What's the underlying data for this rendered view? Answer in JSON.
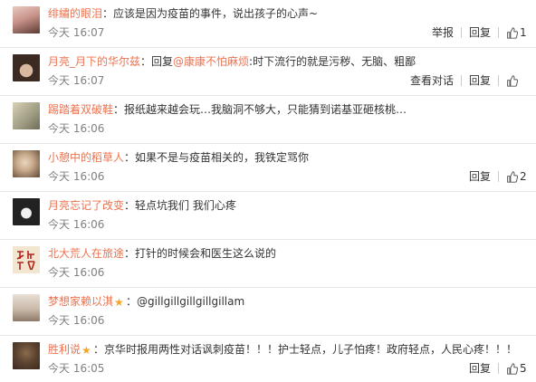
{
  "comments": [
    {
      "username": "绯繡的眼泪",
      "text": "：应该是因为疫苗的事件，说出孩子的心声~",
      "time": "今天 16:07",
      "actions": [
        "举报",
        "回复"
      ],
      "likes": "1",
      "avatar_colors": [
        "#e8c9c0",
        "#5a3b33"
      ],
      "star": false
    },
    {
      "username": "月亮_月下的华尔兹",
      "prefix": "：回复",
      "mention": "@康康不怕麻烦",
      "text": ":时下流行的就是污秽、无脑、粗鄙",
      "time": "今天 16:07",
      "actions": [
        "查看对话",
        "回复"
      ],
      "likes": "",
      "avatar_colors": [
        "#3a2a22",
        "#d9b8a0"
      ],
      "star": false
    },
    {
      "username": "踢踏着双破鞋",
      "text": "：报纸越来越会玩…我脑洞不够大，只能猜到诺基亚砸核桃…",
      "time": "今天 16:06",
      "actions": [],
      "likes": "",
      "avatar_colors": [
        "#9c9a80",
        "#d8d2b8"
      ],
      "star": false
    },
    {
      "username": "小憩中的稻草人",
      "text": "：如果不是与疫苗相关的，我铁定骂你",
      "time": "今天 16:06",
      "actions": [
        "回复"
      ],
      "likes": "2",
      "avatar_colors": [
        "#c7a98a",
        "#5b4636"
      ],
      "star": false
    },
    {
      "username": "月亮忘记了改变",
      "text": "：轻点坑我们 我们心疼",
      "time": "今天 16:06",
      "actions": [],
      "likes": "",
      "avatar_colors": [
        "#222222",
        "#f0f0f0"
      ],
      "star": false
    },
    {
      "username": "北大荒人在旅途",
      "text": "：打针的时候会和医生这么说的",
      "time": "今天 16:06",
      "actions": [],
      "likes": "",
      "avatar_colors": [
        "#b8201d",
        "#f2e6d0"
      ],
      "star": false
    },
    {
      "username": "梦想家赖以淇",
      "text": "：@gillgillgillgillgillam",
      "time": "今天 16:06",
      "actions": [],
      "likes": "",
      "avatar_colors": [
        "#c9b9a9",
        "#e9dfd5"
      ],
      "star": true
    },
    {
      "username": "胜利说",
      "text": "：京华时报用两性对话讽刺疫苗！！！护士轻点，儿子怕疼！政府轻点，人民心疼！！！",
      "time": "今天 16:05",
      "actions": [
        "回复"
      ],
      "likes": "5",
      "avatar_colors": [
        "#3b2a1e",
        "#8a6a4a"
      ],
      "star": true
    }
  ],
  "colors": {
    "username": "#eb7350",
    "time": "#808080",
    "star": "#f5a623"
  }
}
